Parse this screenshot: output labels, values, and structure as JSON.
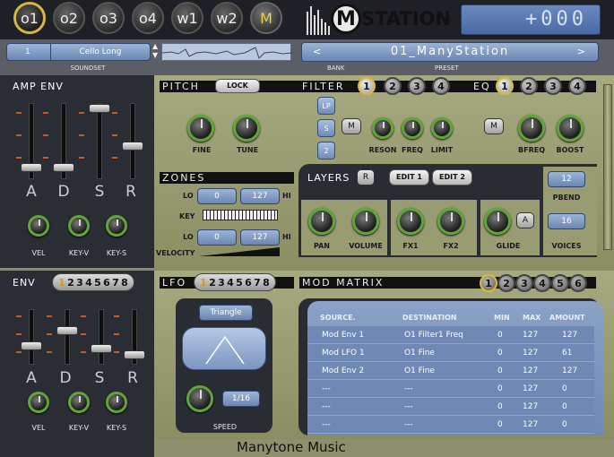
{
  "top_buttons": [
    "o1",
    "o2",
    "o3",
    "o4",
    "w1",
    "w2",
    "M"
  ],
  "logo": {
    "text": "STATION",
    "m": "M"
  },
  "lcd": {
    "value": "+000"
  },
  "soundset": {
    "number": "1",
    "name": "Cello Long",
    "label": "SOUNDSET"
  },
  "bank": {
    "name": "01_ManyStation",
    "bank_label": "BANK",
    "preset_label": "PRESET",
    "prev": "<",
    "next": ">"
  },
  "amp_env": {
    "title": "AMP ENV",
    "letters": [
      "A",
      "D",
      "S",
      "R"
    ],
    "knobs": [
      "VEL",
      "KEY-V",
      "KEY-S"
    ]
  },
  "env": {
    "title": "ENV",
    "tabs": [
      "1",
      "2",
      "3",
      "4",
      "5",
      "6",
      "7",
      "8"
    ],
    "letters": [
      "A",
      "D",
      "S",
      "R"
    ],
    "knobs": [
      "VEL",
      "KEY-V",
      "KEY-S"
    ]
  },
  "pitch": {
    "title": "PITCH",
    "lock": "LOCK",
    "knobs": [
      "FINE",
      "TUNE"
    ]
  },
  "filter": {
    "title": "FILTER",
    "buttons": [
      "1",
      "2",
      "3",
      "4"
    ],
    "modes": [
      "LP",
      "S",
      "2"
    ],
    "m": "M",
    "knobs": [
      "RESON",
      "FREQ",
      "LIMIT"
    ]
  },
  "eq": {
    "title": "EQ",
    "buttons": [
      "1",
      "2",
      "3",
      "4"
    ],
    "m": "M",
    "knobs": [
      "BFREQ",
      "BOOST"
    ]
  },
  "zones": {
    "title": "ZONES",
    "lo": "LO",
    "hi": "HI",
    "key_label": "KEY",
    "velocity_label": "VELOCITY",
    "key_lo": "0",
    "key_hi": "127",
    "vel_lo": "0",
    "vel_hi": "127"
  },
  "layers": {
    "title": "LAYERS",
    "r": "R",
    "edit1": "EDIT 1",
    "edit2": "EDIT 2",
    "knobs": [
      "PAN",
      "VOLUME",
      "FX1",
      "FX2",
      "GLIDE"
    ],
    "a": "A",
    "pbend_value": "12",
    "pbend_label": "PBEND",
    "voices_value": "16",
    "voices_label": "VOICES"
  },
  "lfo": {
    "title": "LFO",
    "tabs": [
      "1",
      "2",
      "3",
      "4",
      "5",
      "6",
      "7",
      "8"
    ],
    "wave": "Triangle",
    "rate": "1/16",
    "speed_label": "SPEED"
  },
  "mod_matrix": {
    "title": "MOD MATRIX",
    "buttons": [
      "1",
      "2",
      "3",
      "4",
      "5",
      "6"
    ],
    "headers": [
      "SOURCE.",
      "DESTINATION",
      "MIN",
      "MAX",
      "AMOUNT"
    ],
    "rows": [
      [
        "Mod Env 1",
        "O1 Filter1 Freq",
        "0",
        "127",
        "127"
      ],
      [
        "Mod LFO 1",
        "O1 Fine",
        "0",
        "127",
        "61"
      ],
      [
        "Mod Env 2",
        "O1 Fine",
        "0",
        "127",
        "127"
      ],
      [
        "---",
        "---",
        "0",
        "127",
        "0"
      ],
      [
        "---",
        "---",
        "0",
        "127",
        "0"
      ],
      [
        "---",
        "---",
        "0",
        "127",
        "0"
      ]
    ]
  },
  "footer": {
    "brand": "Manytone Music"
  }
}
